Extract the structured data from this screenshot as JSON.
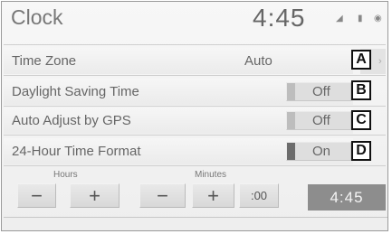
{
  "header": {
    "title": "Clock",
    "time": "4:45",
    "status_icons": [
      "signal-icon",
      "battery-icon",
      "settings-icon"
    ]
  },
  "rows": [
    {
      "label": "Time Zone",
      "value": "Auto",
      "callout": "A"
    },
    {
      "label": "Daylight Saving Time",
      "toggle": "Off",
      "callout": "B"
    },
    {
      "label": "Auto Adjust by GPS",
      "toggle": "Off",
      "callout": "C"
    },
    {
      "label": "24-Hour Time Format",
      "toggle": "On",
      "callout": "D"
    }
  ],
  "adjust": {
    "hours_label": "Hours",
    "minutes_label": "Minutes",
    "minus": "−",
    "plus": "+",
    "zero": ":00",
    "time_display": "4:45"
  },
  "colors": {
    "background": "#efefef",
    "toggle_on_indicator": "#6c6c6c",
    "toggle_off_indicator": "#bdbdbd",
    "time_display_bg": "#8d8d8d"
  }
}
